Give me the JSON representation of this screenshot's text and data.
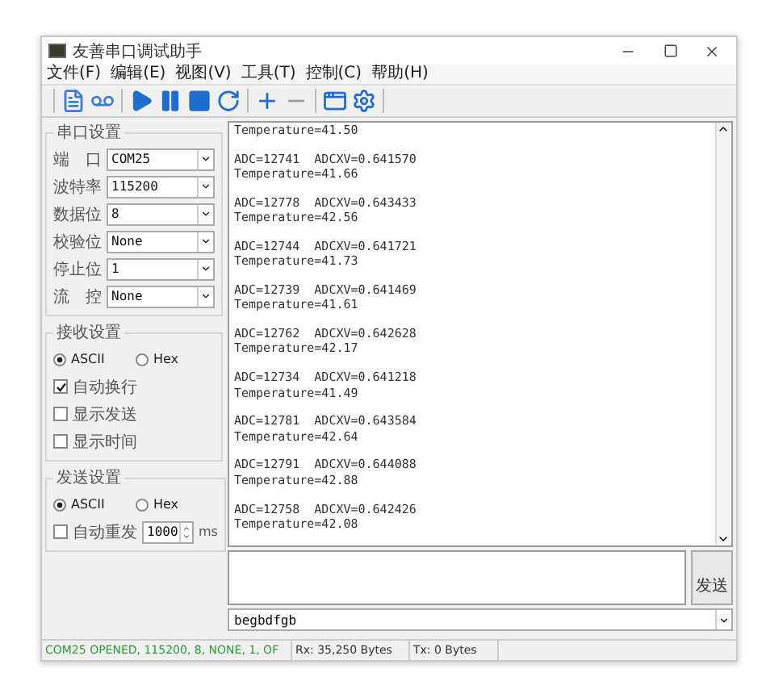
{
  "window": {
    "title": "友善串口调试助手"
  },
  "menu": [
    "文件(F)",
    "编辑(E)",
    "视图(V)",
    "工具(T)",
    "控制(C)",
    "帮助(H)"
  ],
  "serial_settings": {
    "title": "串口设置",
    "fields": [
      {
        "label": "端　口",
        "value": "COM25"
      },
      {
        "label": "波特率",
        "value": "115200"
      },
      {
        "label": "数据位",
        "value": "8"
      },
      {
        "label": "校验位",
        "value": "None"
      },
      {
        "label": "停止位",
        "value": "1"
      },
      {
        "label": "流　控",
        "value": "None"
      }
    ]
  },
  "receive_settings": {
    "title": "接收设置",
    "modes": [
      {
        "label": "ASCII",
        "selected": true
      },
      {
        "label": "Hex",
        "selected": false
      }
    ],
    "options": [
      {
        "label": "自动换行",
        "checked": true
      },
      {
        "label": "显示发送",
        "checked": false
      },
      {
        "label": "显示时间",
        "checked": false
      }
    ]
  },
  "send_settings": {
    "title": "发送设置",
    "modes": [
      {
        "label": "ASCII",
        "selected": true
      },
      {
        "label": "Hex",
        "selected": false
      }
    ],
    "auto_resend": {
      "label": "自动重发",
      "checked": false,
      "interval": "1000",
      "unit": "ms"
    }
  },
  "output": [
    [
      "Temperature=41.50"
    ],
    [
      "ADC=12741  ADCXV=0.641570",
      "Temperature=41.66"
    ],
    [
      "ADC=12778  ADCXV=0.643433",
      "Temperature=42.56"
    ],
    [
      "ADC=12744  ADCXV=0.641721",
      "Temperature=41.73"
    ],
    [
      "ADC=12739  ADCXV=0.641469",
      "Temperature=41.61"
    ],
    [
      "ADC=12762  ADCXV=0.642628",
      "Temperature=42.17"
    ],
    [
      "ADC=12734  ADCXV=0.641218",
      "Temperature=41.49"
    ],
    [
      "ADC=12781  ADCXV=0.643584",
      "Temperature=42.64"
    ],
    [
      "ADC=12791  ADCXV=0.644088",
      "Temperature=42.88"
    ],
    [
      "ADC=12758  ADCXV=0.642426",
      "Temperature=42.08"
    ]
  ],
  "send_button": "发送",
  "send_history": {
    "value": "begbdfgb"
  },
  "status_bar": {
    "port": "COM25 OPENED, 115200, 8, NONE, 1, OF",
    "rx": "Rx: 35,250 Bytes",
    "tx": "Tx: 0 Bytes"
  }
}
